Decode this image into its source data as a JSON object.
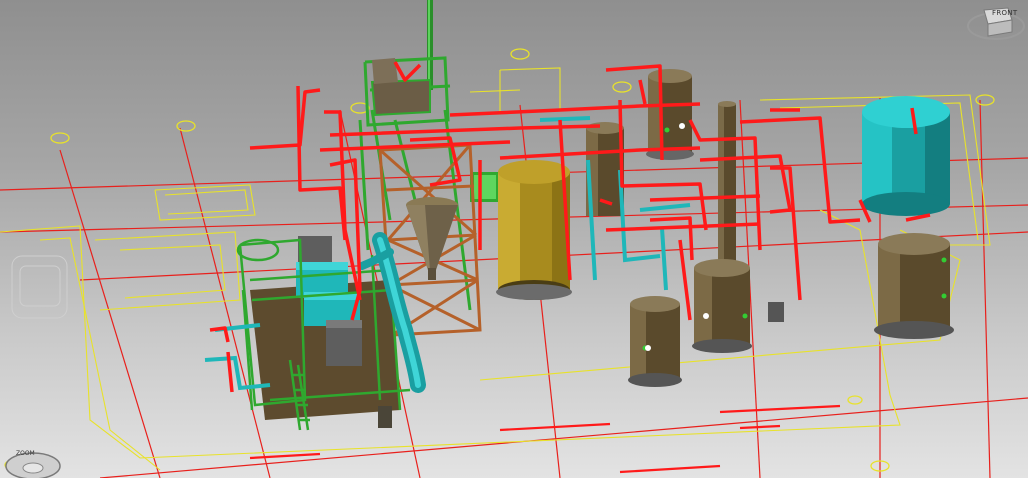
{
  "viewcube": {
    "face_label": "FRONT",
    "icon": "viewcube-icon"
  },
  "zoom_control": {
    "label": "ZOOM",
    "icon": "zoom-icon"
  },
  "colors": {
    "background_top": "#8f8f8f",
    "background_bottom": "#e3e3e3",
    "grid_red": "#e8201c",
    "floor_yellow": "#e8e22a",
    "pipe_red": "#ff1a1a",
    "structure_green": "#2fa82f",
    "equipment_cyan": "#1fb7b9",
    "tank_bronze": "#5a4a2c",
    "tank_gold": "#a88b1e",
    "frame_orange": "#b5612a"
  }
}
